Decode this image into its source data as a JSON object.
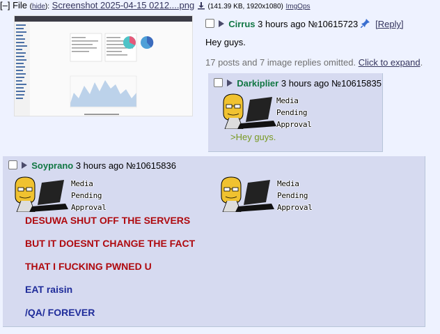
{
  "file_bar": {
    "toggle": "[–]",
    "label": "File",
    "hide": "hide",
    "filename": "Screenshot 2025-04-15 0212....png",
    "meta": "(141.39 KB, 1920x1080)",
    "imgops": "ImgOps"
  },
  "op": {
    "name": "Cirrus",
    "time": "3 hours ago",
    "number": "№10615723",
    "reply": "[Reply]",
    "text": "Hey guys.",
    "omitted_text": "17 posts and 7 image replies omitted.",
    "expand": "Click to expand",
    "period": "."
  },
  "replies": [
    {
      "name": "Darkiplier",
      "time": "3 hours ago",
      "number": "№10615835",
      "media_lines": [
        "Media",
        "Pending",
        "Approval"
      ],
      "greentext": ">Hey guys."
    },
    {
      "name": "Soyprano",
      "time": "3 hours ago",
      "number": "№10615836",
      "media_lines": [
        "Media",
        "Pending",
        "Approval"
      ],
      "lines": [
        "DESUWA SHUT OFF THE SERVERS",
        "BUT IT DOESNT CHANGE THE FACT",
        "THAT I FUCKING PWNED U",
        "EAT raisin",
        "/QA/ FOREVER"
      ]
    }
  ],
  "colors": {
    "background": "#eef2ff",
    "reply_bg": "#d6daf0",
    "name": "#117743",
    "greentext": "#789922",
    "red": "#af0a0f",
    "blue": "#1f2c9a"
  }
}
